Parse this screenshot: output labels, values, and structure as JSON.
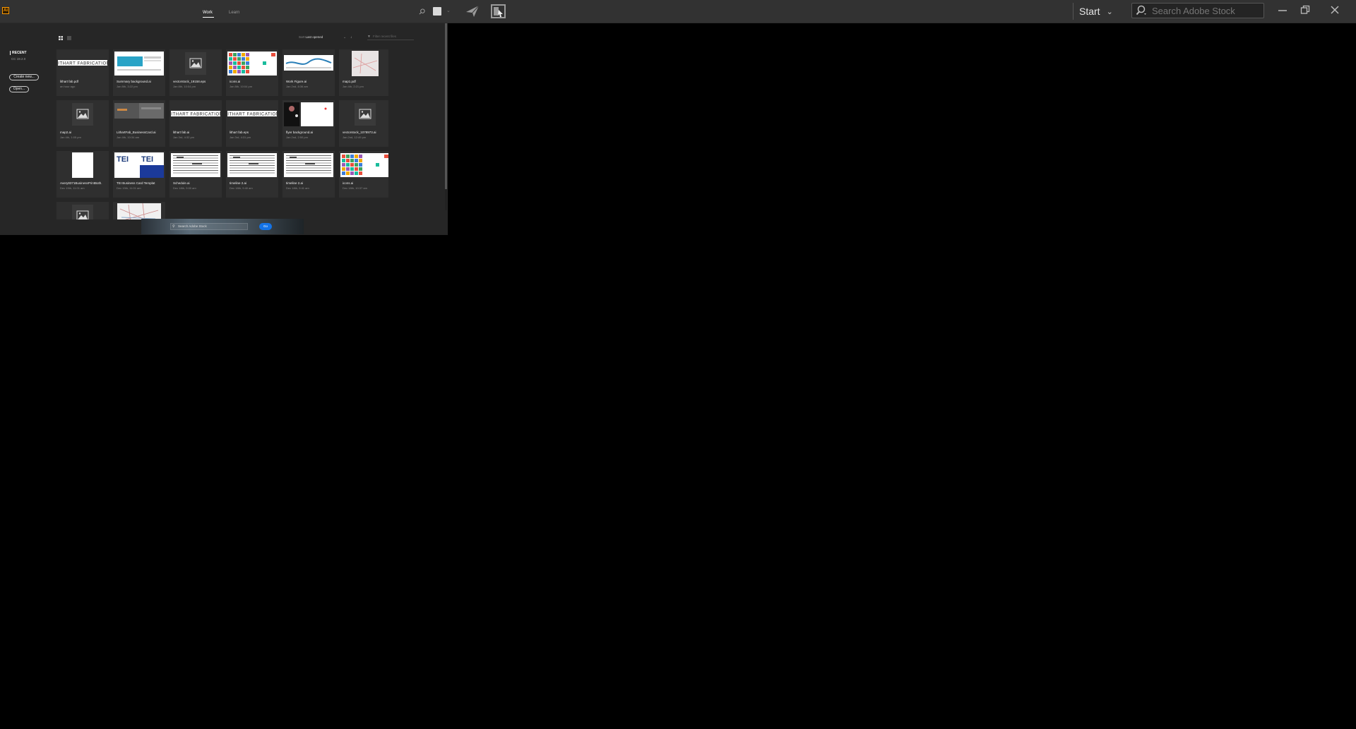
{
  "app": {
    "logo_text": "Ai",
    "tabs": [
      {
        "label": "Work"
      },
      {
        "label": "Learn"
      }
    ],
    "workspace": {
      "label": "Start"
    },
    "stock_search": {
      "placeholder": "Search Adobe Stock"
    }
  },
  "home": {
    "sidebar": {
      "recent_label": "RECENT",
      "version": "CC 19.2.0",
      "create_label": "Create new...",
      "open_label": "Open..."
    },
    "sort": {
      "prefix": "Sort",
      "value": "Last opened"
    },
    "filter": {
      "placeholder": "Filter recent files"
    },
    "banner": {
      "search_placeholder": "Search Adobe Stock",
      "go_label": "Go"
    },
    "files": [
      {
        "name": "lithart fab.pdf",
        "date": "an hour ago",
        "thumb": "logo"
      },
      {
        "name": "Summary background.ai",
        "date": "Jan 8th, 3:22 pm",
        "thumb": "doc-blue"
      },
      {
        "name": "vectorstock_19158.eps",
        "date": "Jan 8th, 10:04 pm",
        "thumb": "placeholder"
      },
      {
        "name": "icons.ai",
        "date": "Jan 8th, 10:04 pm",
        "thumb": "icons"
      },
      {
        "name": "Work Figure.ai",
        "date": "Jan 2nd, 8:36 am",
        "thumb": "chart"
      },
      {
        "name": "map1.pdf",
        "date": "Jan 4th, 2:21 pm",
        "thumb": "map-small"
      },
      {
        "name": "map2.ai",
        "date": "Jan 4th, 1:05 pm",
        "thumb": "placeholder"
      },
      {
        "name": "LithartFab_BusinessCard.ai",
        "date": "Jan 4th, 10:34 am",
        "thumb": "card-grey"
      },
      {
        "name": "lithart fab.ai",
        "date": "Jan 3rd, 4:32 pm",
        "thumb": "logo"
      },
      {
        "name": "lithart fab.eps",
        "date": "Jan 3rd, 4:31 pm",
        "thumb": "logo"
      },
      {
        "name": "flyer background.ai",
        "date": "Jan 2nd, 2:50 pm",
        "thumb": "flyer"
      },
      {
        "name": "vectorstock_1078973.ai",
        "date": "Jan 2nd, 12:49 pm",
        "thumb": "placeholder"
      },
      {
        "name": "Avery8371BusinessPrintBoth.",
        "date": "Dec 19th, 11:01 am",
        "thumb": "white-page"
      },
      {
        "name": "TEI Business Card Templat",
        "date": "Dec 19th, 11:01 am",
        "thumb": "tei"
      },
      {
        "name": "Schedule.ai",
        "date": "Dec 18th, 9:00 am",
        "thumb": "schedule"
      },
      {
        "name": "timeline 2.ai",
        "date": "Dec 18th, 9:40 am",
        "thumb": "schedule"
      },
      {
        "name": "timeline 2.ai",
        "date": "Dec 18th, 9:41 am",
        "thumb": "schedule"
      },
      {
        "name": "icons.ai",
        "date": "Dec 18th, 10:37 am",
        "thumb": "icons"
      },
      {
        "name": "",
        "date": "",
        "thumb": "placeholder"
      },
      {
        "name": "",
        "date": "",
        "thumb": "map-big"
      }
    ]
  },
  "colors": {
    "accent": "#1473e6",
    "ai_orange": "#ff9a00",
    "panel": "#262626"
  }
}
